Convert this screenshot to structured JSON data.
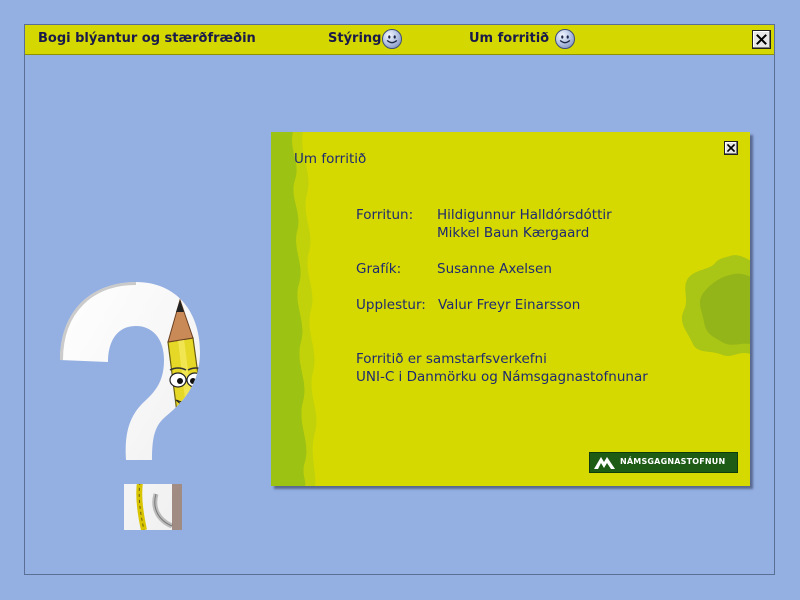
{
  "topbar": {
    "app_title": "Bogi blýantur og stærðfræðin",
    "controls_label": "Stýring",
    "about_label": "Um forritið",
    "close_label": "X",
    "icons": {
      "controls": "smiley-face-icon",
      "about": "smiley-face-icon",
      "close": "close-icon"
    }
  },
  "dialog": {
    "title": "Um forritið",
    "close_label": "X",
    "credits": [
      {
        "role": "Forritun:",
        "names": [
          "Hildigunnur Halldórsdóttir",
          "Mikkel Baun Kærgaard"
        ]
      },
      {
        "role": "Grafík:",
        "names": [
          "Susanne Axelsen"
        ]
      },
      {
        "role": "Upplestur:",
        "names": [
          "Valur Freyr Einarsson"
        ]
      }
    ],
    "note_line1": "Forritið er samstarfsverkefni",
    "note_line2": "UNI-C i Danmörku og  Námsgagnastofnunar",
    "publisher": "NÁMSGAGNASTOFNUN"
  },
  "colors": {
    "background": "#94afe2",
    "bar": "#d4d800",
    "dialog": "#d6d900",
    "dialog_edge": "#9cc214",
    "text": "#1e2a70",
    "publisher_logo": "#1e5c16"
  }
}
